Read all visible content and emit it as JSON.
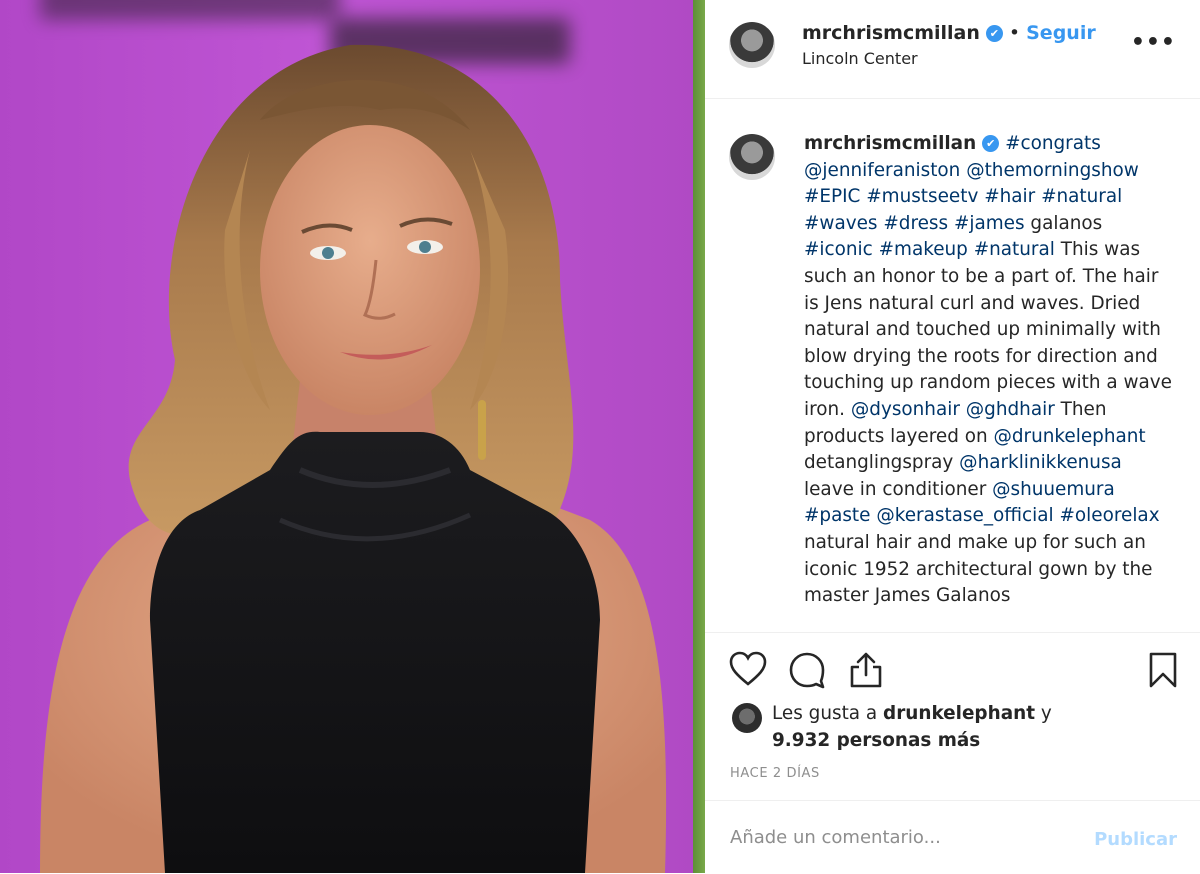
{
  "post": {
    "username": "mrchrismcmillan",
    "verified_badge": "✔",
    "separator": "•",
    "follow_label": "Seguir",
    "location": "Lincoln Center",
    "more_icon": "more-options-icon"
  },
  "caption": {
    "username": "mrchrismcmillan",
    "segments": [
      {
        "text": "#congrats",
        "link": true
      },
      {
        "text": " ",
        "link": false
      },
      {
        "text": "@jenniferaniston",
        "link": true
      },
      {
        "text": " ",
        "link": false
      },
      {
        "text": "@themorningshow",
        "link": true
      },
      {
        "text": " ",
        "link": false
      },
      {
        "text": "#EPIC",
        "link": true
      },
      {
        "text": " ",
        "link": false
      },
      {
        "text": "#mustseetv",
        "link": true
      },
      {
        "text": " ",
        "link": false
      },
      {
        "text": "#hair",
        "link": true
      },
      {
        "text": " ",
        "link": false
      },
      {
        "text": "#natural",
        "link": true
      },
      {
        "text": " ",
        "link": false
      },
      {
        "text": "#waves",
        "link": true
      },
      {
        "text": " ",
        "link": false
      },
      {
        "text": "#dress",
        "link": true
      },
      {
        "text": " ",
        "link": false
      },
      {
        "text": "#james",
        "link": true
      },
      {
        "text": " galanos ",
        "link": false
      },
      {
        "text": "#iconic",
        "link": true
      },
      {
        "text": " ",
        "link": false
      },
      {
        "text": "#makeup",
        "link": true
      },
      {
        "text": " ",
        "link": false
      },
      {
        "text": "#natural",
        "link": true
      },
      {
        "text": " This was such an honor to be a part of. The hair is Jens natural curl and waves. Dried natural and touched up minimally with blow drying the roots for direction and touching up random pieces with a wave iron. ",
        "link": false
      },
      {
        "text": "@dysonhair",
        "link": true
      },
      {
        "text": " ",
        "link": false
      },
      {
        "text": "@ghdhair",
        "link": true
      },
      {
        "text": " Then products layered on ",
        "link": false
      },
      {
        "text": "@drunkelephant",
        "link": true
      },
      {
        "text": " detanglingspray ",
        "link": false
      },
      {
        "text": "@harklinikkenusa",
        "link": true
      },
      {
        "text": " leave in conditioner ",
        "link": false
      },
      {
        "text": "@shuuemura",
        "link": true
      },
      {
        "text": " ",
        "link": false
      },
      {
        "text": "#paste",
        "link": true
      },
      {
        "text": " ",
        "link": false
      },
      {
        "text": "@kerastase_official",
        "link": true
      },
      {
        "text": " ",
        "link": false
      },
      {
        "text": "#oleorelax",
        "link": true
      },
      {
        "text": " natural hair and make up for such an iconic 1952 architectural gown by the master James Galanos",
        "link": false
      }
    ]
  },
  "actions": {
    "icons": [
      "heart-icon",
      "comment-icon",
      "share-icon",
      "bookmark-icon"
    ]
  },
  "likes": {
    "prefix": "Les gusta a",
    "user": "drunkelephant",
    "conj": "y",
    "count_text": "9.932 personas más"
  },
  "timestamp": "HACE 2 DÍAS",
  "comment": {
    "placeholder": "Añade un comentario...",
    "publish_label": "Publicar"
  },
  "colors": {
    "link": "#003569",
    "follow": "#3897f0",
    "publish_disabled": "#b3dbff",
    "photo_background": "#bf55d4"
  }
}
